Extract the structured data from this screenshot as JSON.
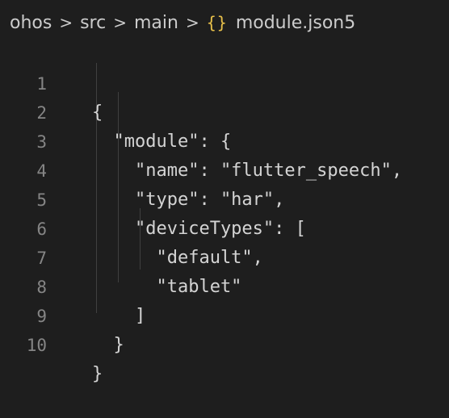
{
  "breadcrumb": {
    "items": [
      "ohos",
      "src",
      "main"
    ],
    "separator": ">",
    "file_icon": "json-braces-icon",
    "file_icon_glyph": "{}",
    "file_name": "module.json5"
  },
  "editor": {
    "lines": [
      {
        "number": "1",
        "text": "{"
      },
      {
        "number": "2",
        "text": "  \"module\": {"
      },
      {
        "number": "3",
        "text": "    \"name\": \"flutter_speech\","
      },
      {
        "number": "4",
        "text": "    \"type\": \"har\","
      },
      {
        "number": "5",
        "text": "    \"deviceTypes\": ["
      },
      {
        "number": "6",
        "text": "      \"default\","
      },
      {
        "number": "7",
        "text": "      \"tablet\""
      },
      {
        "number": "8",
        "text": "    ]"
      },
      {
        "number": "9",
        "text": "  }"
      },
      {
        "number": "10",
        "text": "}"
      }
    ]
  },
  "colors": {
    "background": "#1e1e1e",
    "text": "#d4d4d4",
    "line_number": "#858585",
    "json_icon": "#e8c04a"
  }
}
